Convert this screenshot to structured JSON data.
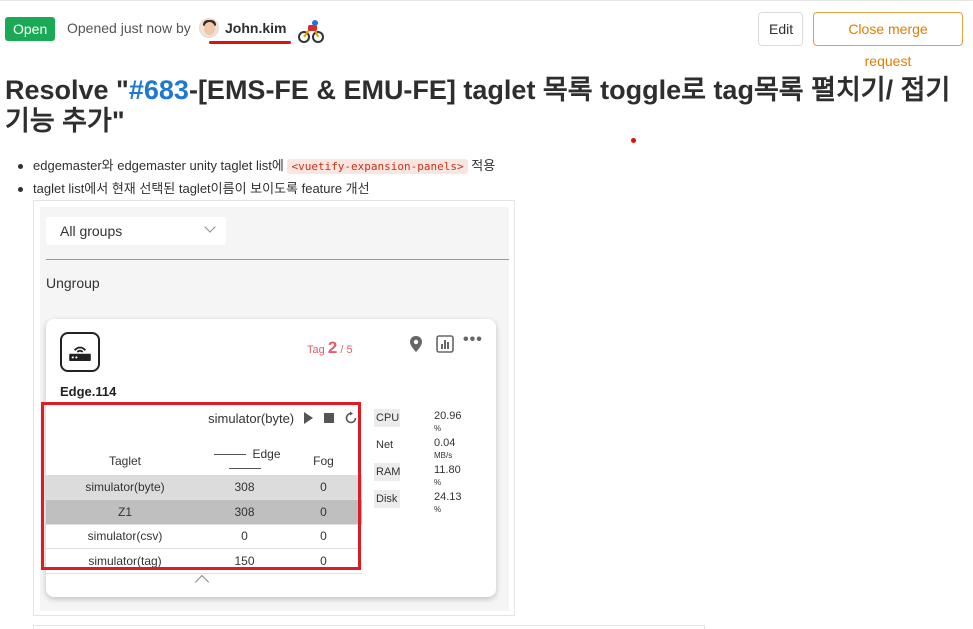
{
  "header": {
    "status": "Open",
    "opened_text": "Opened just now by",
    "author": "John.kim",
    "edit_label": "Edit",
    "close_label": "Close merge request"
  },
  "title": {
    "prefix": "Resolve \"",
    "issue_ref": "#683",
    "rest": "-[EMS-FE & EMU-FE] taglet 목록 toggle로 tag목록 펼치기/ 접기 기능 추가\""
  },
  "description": {
    "bullet1_before": "edgemaster와 edgemaster unity taglet list에",
    "bullet1_code": "<vuetify-expansion-panels>",
    "bullet1_after": "적용",
    "bullet2": "taglet list에서 현재 선택된 taglet이름이 보이도록 feature 개선"
  },
  "screenshot": {
    "groups_select": "All groups",
    "ungroup_label": "Ungroup",
    "device_name": "Edge.114",
    "tag_label": "Tag",
    "tag_current": "2",
    "tag_total": "/ 5",
    "simulator_header": "simulator(byte)",
    "table": {
      "headers": {
        "taglet": "Taglet",
        "edge": "Edge",
        "fog": "Fog"
      },
      "rows": [
        {
          "taglet": "simulator(byte)",
          "edge": "308",
          "fog": "0"
        },
        {
          "taglet": "Z1",
          "edge": "308",
          "fog": "0"
        },
        {
          "taglet": "simulator(csv)",
          "edge": "0",
          "fog": "0"
        },
        {
          "taglet": "simulator(tag)",
          "edge": "150",
          "fog": "0"
        }
      ]
    },
    "metrics": [
      {
        "label": "CPU",
        "value": "20.96",
        "unit": "%"
      },
      {
        "label": "Net",
        "value": "0.04",
        "unit": "MB/s"
      },
      {
        "label": "RAM",
        "value": "11.80",
        "unit": "%"
      },
      {
        "label": "Disk",
        "value": "24.13",
        "unit": "%"
      }
    ]
  },
  "colors": {
    "open_badge": "#1aaa55",
    "link": "#1f78d1",
    "close_button": "#de7e00",
    "highlight_frame": "#dd1c24",
    "tag_accent": "#e25d6a"
  }
}
